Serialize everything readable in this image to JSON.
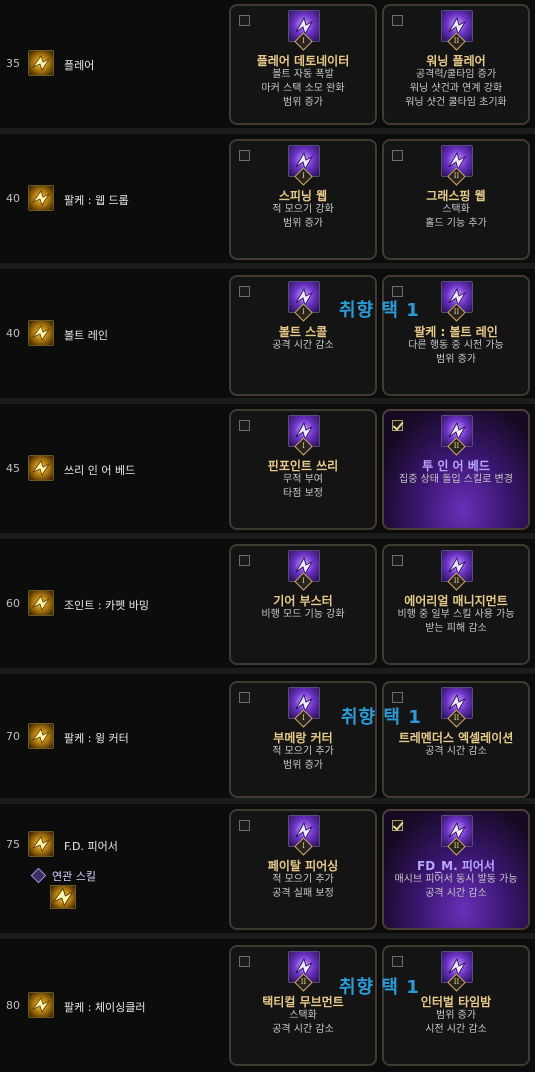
{
  "rows": [
    {
      "level": "35",
      "name": "플레어",
      "icon": "burst-icon",
      "cards": [
        {
          "rank": "I",
          "title": "플레어 데토네이터",
          "desc": [
            "볼트 자동 폭발",
            "마커 스택 소모 완화",
            "범위 증가"
          ],
          "checked": false,
          "selected": false
        },
        {
          "rank": "II",
          "title": "워닝 플레어",
          "desc": [
            "공격력/쿨타임 증가",
            "워닝 샷건과 연계 강화",
            "워닝 샷건 쿨타임 초기화"
          ],
          "checked": false,
          "selected": false
        }
      ]
    },
    {
      "level": "40",
      "name": "팔케 : 웹 드롭",
      "icon": "web-drop-icon",
      "cards": [
        {
          "rank": "I",
          "title": "스피닝 웹",
          "desc": [
            "적 모으기 강화",
            "범위 증가"
          ],
          "checked": false,
          "selected": false
        },
        {
          "rank": "II",
          "title": "그래스핑 웹",
          "desc": [
            "스택화",
            "홀드 기능 추가"
          ],
          "checked": false,
          "selected": false
        }
      ]
    },
    {
      "level": "40",
      "name": "볼트 레인",
      "icon": "bolt-rain-icon",
      "overlay": "취향 택 1",
      "cards": [
        {
          "rank": "I",
          "title": "볼트 스콜",
          "desc": [
            "공격 시간 감소"
          ],
          "checked": false,
          "selected": false
        },
        {
          "rank": "II",
          "title": "팔케 : 볼트 레인",
          "desc": [
            "다른 행동 중 시전 가능",
            "범위 증가"
          ],
          "checked": false,
          "selected": false
        }
      ]
    },
    {
      "level": "45",
      "name": "쓰리 인 어 베드",
      "icon": "three-in-a-bed-icon",
      "cards": [
        {
          "rank": "I",
          "title": "핀포인트 쓰리",
          "desc": [
            "무적 부여",
            "타점 보정"
          ],
          "checked": false,
          "selected": false
        },
        {
          "rank": "II",
          "title": "투 인 어 베드",
          "desc": [
            "집중 상태 돌입 스킬로 변경"
          ],
          "checked": true,
          "selected": true
        }
      ]
    },
    {
      "level": "60",
      "name": "조인트 : 카펫 바밍",
      "icon": "carpet-bombing-icon",
      "cards": [
        {
          "rank": "I",
          "title": "기어 부스터",
          "desc": [
            "비행 모드 기능 강화"
          ],
          "checked": false,
          "selected": false
        },
        {
          "rank": "II",
          "title": "에어리얼 매니지먼트",
          "desc": [
            "비행 중 일부 스킬 사용 가능",
            "받는 피해 감소"
          ],
          "checked": false,
          "selected": false
        }
      ]
    },
    {
      "level": "70",
      "name": "팔케 : 윙 커터",
      "icon": "wing-cutter-icon",
      "overlay": "취향 택 1",
      "cards": [
        {
          "rank": "I",
          "title": "부메랑 커터",
          "desc": [
            "적 모으기 추가",
            "범위 증가"
          ],
          "checked": false,
          "selected": false
        },
        {
          "rank": "II",
          "title": "트레멘더스 엑셀레이션",
          "desc": [
            "공격 시간 감소"
          ],
          "checked": false,
          "selected": false
        }
      ]
    },
    {
      "level": "75",
      "name": "F.D. 피어서",
      "icon": "fd-piercer-icon",
      "related_label": "연관 스킬",
      "cards": [
        {
          "rank": "I",
          "title": "페이탈 피어싱",
          "desc": [
            "적 모으기 추가",
            "공격 실패 보정"
          ],
          "checked": false,
          "selected": false
        },
        {
          "rank": "II",
          "title": "FD_M. 피어서",
          "desc": [
            "매시브 피어서 동시 발동 가능",
            "공격 시간 감소"
          ],
          "checked": true,
          "selected": true
        }
      ]
    },
    {
      "level": "80",
      "name": "팔케 : 체이싱클러",
      "icon": "chasing-icon",
      "overlay": "취향 택 1",
      "cards": [
        {
          "rank": "II",
          "title": "택티컬 무브먼트",
          "desc": [
            "스택화",
            "공격 시간 감소"
          ],
          "checked": false,
          "selected": false
        },
        {
          "rank": "II",
          "title": "인터벌 타임밤",
          "desc": [
            "범위 증가",
            "시전 시간 감소"
          ],
          "checked": false,
          "selected": false
        }
      ]
    }
  ]
}
